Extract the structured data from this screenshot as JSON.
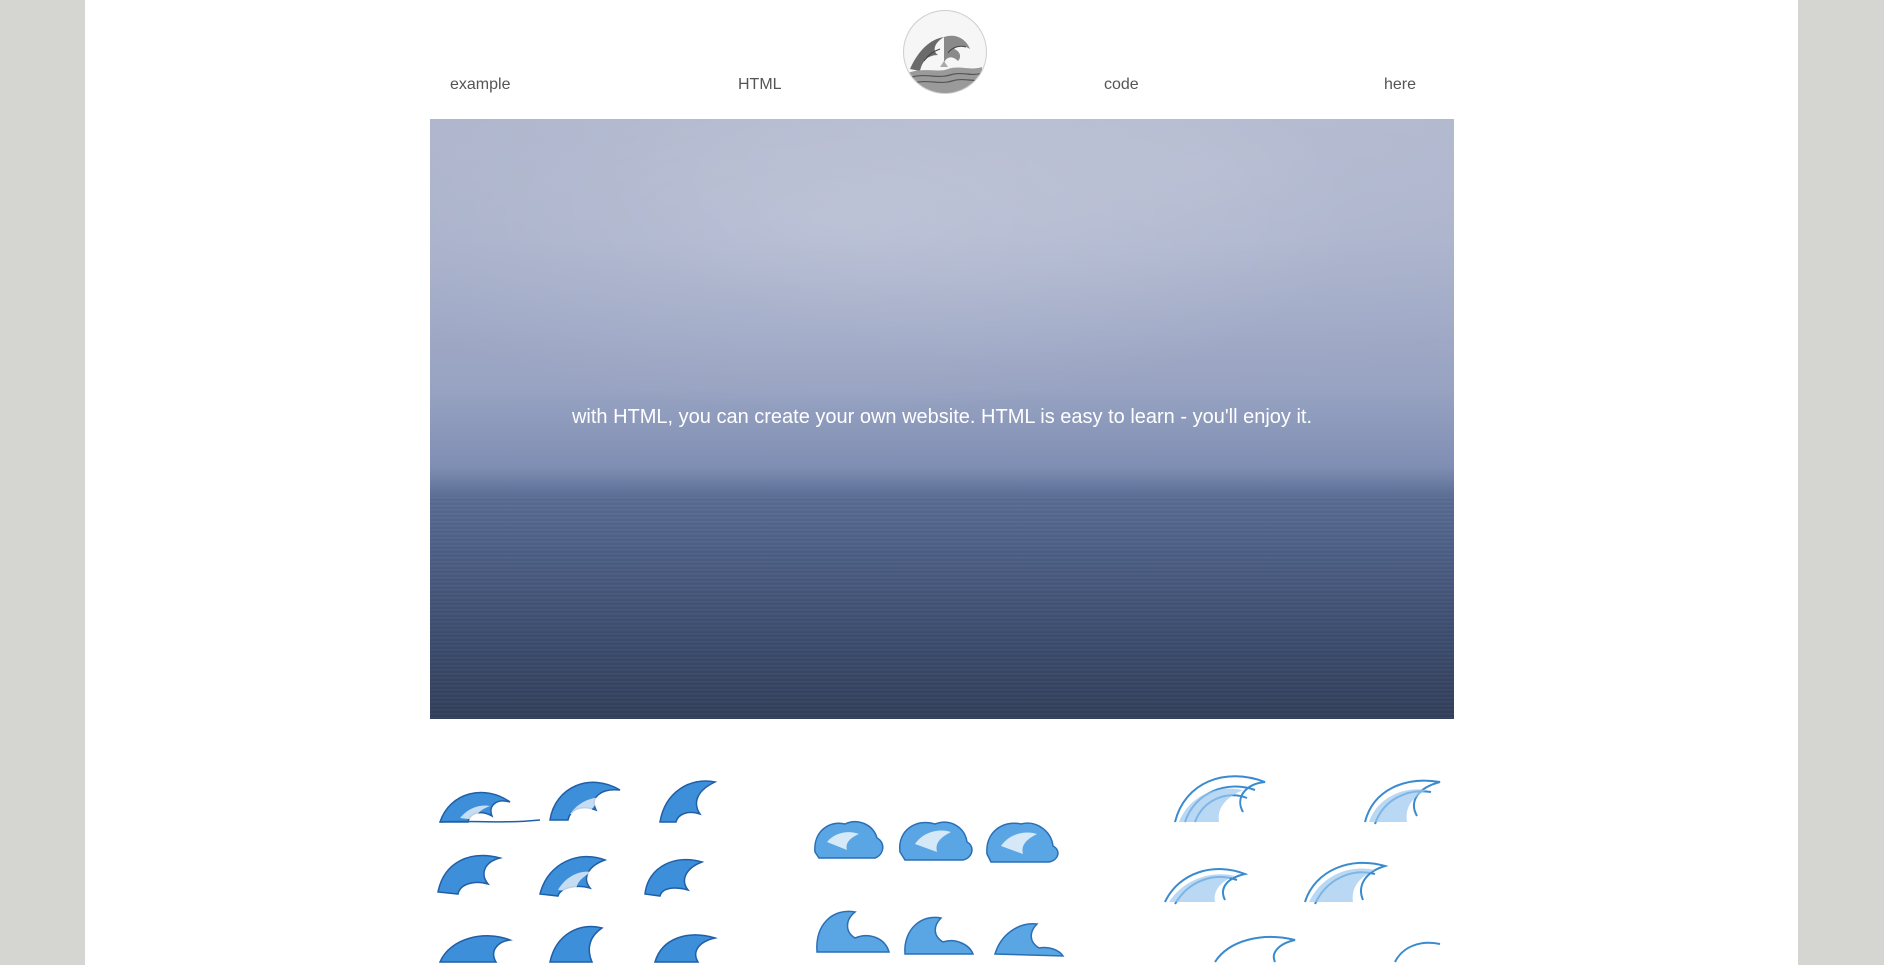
{
  "nav": {
    "links": [
      {
        "label": "example"
      },
      {
        "label": "HTML"
      },
      {
        "label": "code"
      },
      {
        "label": "here"
      }
    ],
    "logo_icon": "great-wave-logo"
  },
  "hero": {
    "text": "with HTML, you can create your own website. HTML is easy to learn - you'll enjoy it.",
    "image": "ocean-horizon-photo"
  },
  "gallery": {
    "images": [
      "blue-waves-set-1",
      "blue-waves-set-2",
      "blue-waves-set-3"
    ]
  },
  "colors": {
    "background": "#d5d6d2",
    "page": "#ffffff",
    "nav_text": "#555555",
    "wave_blue": "#3c8fd8"
  }
}
